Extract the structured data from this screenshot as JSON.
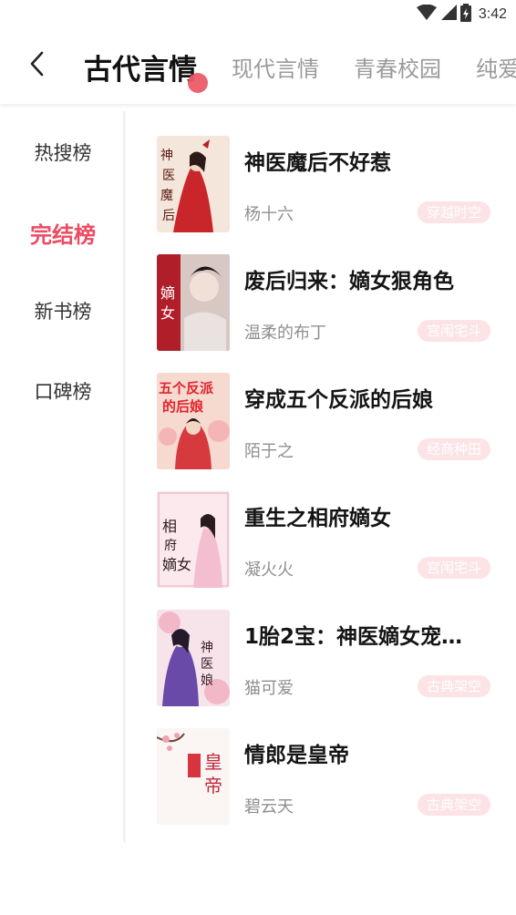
{
  "status_bar": {
    "time": "3:42"
  },
  "header": {
    "tabs": [
      {
        "label": "古代言情",
        "active": true
      },
      {
        "label": "现代言情",
        "active": false
      },
      {
        "label": "青春校园",
        "active": false
      },
      {
        "label": "纯爱",
        "active": false
      }
    ]
  },
  "rail": {
    "items": [
      {
        "label": "热搜榜",
        "active": false
      },
      {
        "label": "完结榜",
        "active": true
      },
      {
        "label": "新书榜",
        "active": false
      },
      {
        "label": "口碑榜",
        "active": false
      }
    ]
  },
  "books": [
    {
      "title": "神医魔后不好惹",
      "author": "杨十六",
      "tag": "穿越时空"
    },
    {
      "title": "废后归来：嫡女狠角色",
      "author": "温柔的布丁",
      "tag": "宫闱宅斗"
    },
    {
      "title": "穿成五个反派的后娘",
      "author": "陌于之",
      "tag": "经商种田"
    },
    {
      "title": "重生之相府嫡女",
      "author": "凝火火",
      "tag": "宫闱宅斗"
    },
    {
      "title": "1胎2宝：神医嫡女宠…",
      "author": "猫可爱",
      "tag": "古典架空"
    },
    {
      "title": "情郎是皇帝",
      "author": "碧云天",
      "tag": "古典架空"
    }
  ],
  "colors": {
    "accent": "#ec4b62",
    "tag_bg": "#fbe3e6"
  }
}
